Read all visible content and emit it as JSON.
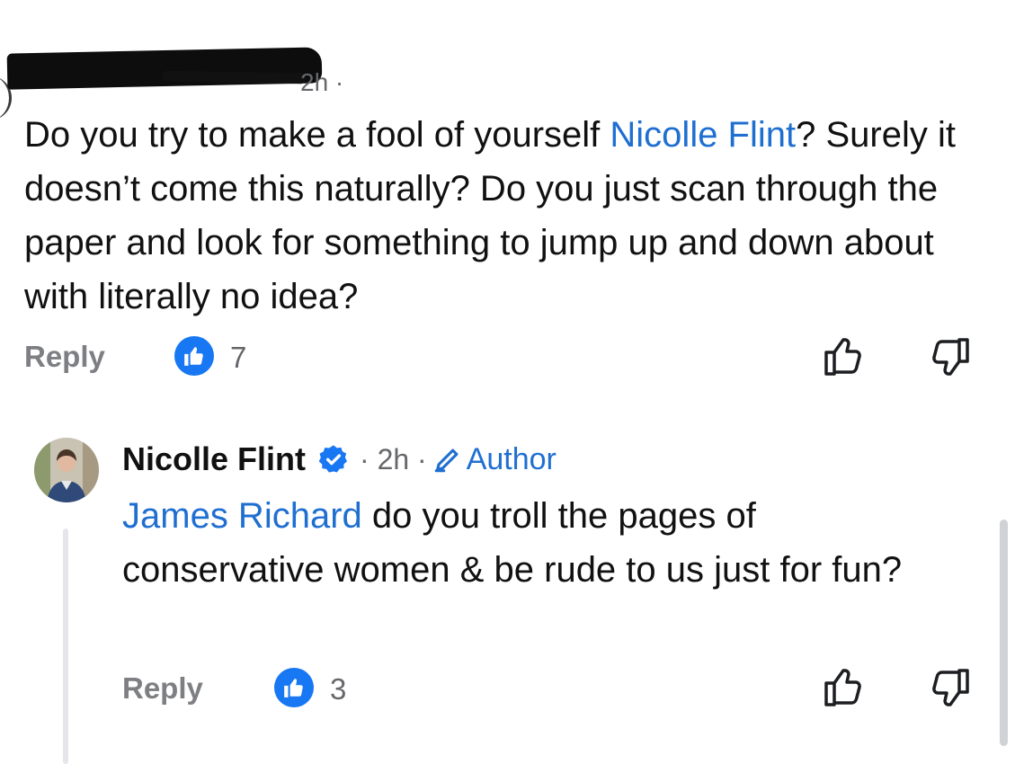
{
  "comment": {
    "time": "2h ·",
    "text_before": "Do you try to make a fool of yourself ",
    "mention": "Nicolle Flint",
    "text_after": "? Surely it doesn’t come this naturally? Do you just scan through the paper and look for something to jump up and down about with literally no idea?",
    "reply_label": "Reply",
    "like_count": "7",
    "like_icon": "thumbs-up-icon",
    "dislike_icon": "thumbs-down-icon"
  },
  "reply": {
    "author": "Nicolle Flint",
    "verified_icon": "verified-badge-icon",
    "time": "· 2h ·",
    "author_tag": "Author",
    "mention": "James Richard",
    "text": " do you troll the pages of conservative women & be rude to us just for fun?",
    "reply_label": "Reply",
    "like_count": "3"
  },
  "colors": {
    "link": "#1f6fd1",
    "like_badge": "#1877f2",
    "meta": "#65676b"
  }
}
